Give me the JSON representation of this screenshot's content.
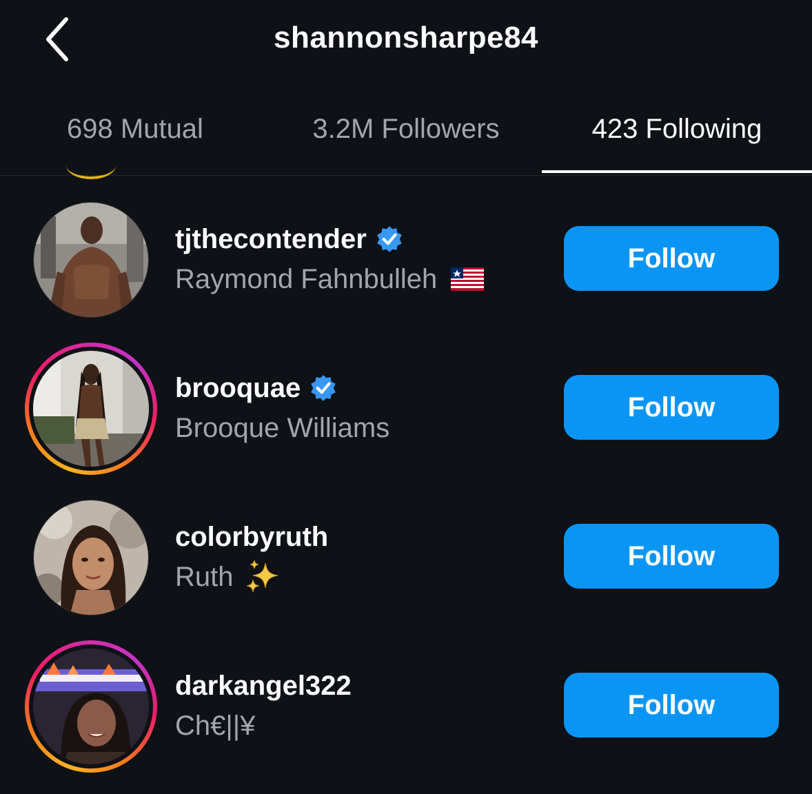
{
  "header": {
    "back_icon": "chevron-left-icon",
    "title": "shannonsharpe84"
  },
  "tabs": [
    {
      "label": "698 Mutual",
      "active": false
    },
    {
      "label": "3.2M Followers",
      "active": false
    },
    {
      "label": "423 Following",
      "active": true
    }
  ],
  "list": [
    {
      "username": "tjthecontender",
      "verified": true,
      "full_name": "Raymond Fahnbulleh",
      "emoji": "liberia-flag-icon",
      "has_story": false,
      "button_label": "Follow"
    },
    {
      "username": "brooquae",
      "verified": true,
      "full_name": "Brooque Williams",
      "emoji": "",
      "has_story": true,
      "button_label": "Follow"
    },
    {
      "username": "colorbyruth",
      "verified": false,
      "full_name": "Ruth",
      "emoji": "sparkles-icon",
      "has_story": false,
      "button_label": "Follow"
    },
    {
      "username": "darkangel322",
      "verified": false,
      "full_name": "Ch€||¥",
      "emoji": "",
      "has_story": true,
      "button_label": "Follow"
    }
  ],
  "colors": {
    "background": "#0e1116",
    "primary_button": "#0a95f6",
    "verified_badge": "#3897f0",
    "secondary_text": "#a3a7ad"
  }
}
